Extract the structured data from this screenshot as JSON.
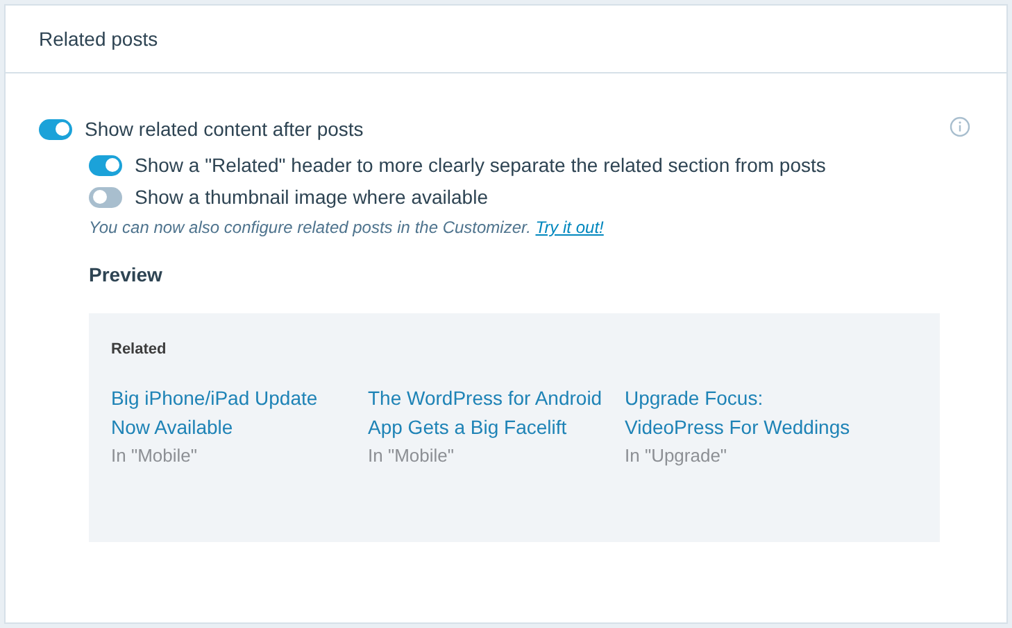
{
  "card": {
    "title": "Related posts"
  },
  "toggles": [
    {
      "label": "Show related content after posts",
      "on": true,
      "kind": "main"
    },
    {
      "label": "Show a \"Related\" header to more clearly separate the related section from posts",
      "on": true,
      "kind": "sub"
    },
    {
      "label": "Show a thumbnail image where available",
      "on": false,
      "kind": "sub"
    }
  ],
  "note": {
    "text": "You can now also configure related posts in the Customizer.",
    "link": "Try it out!"
  },
  "preview": {
    "title": "Preview",
    "heading": "Related",
    "posts": [
      {
        "title": "Big iPhone/iPad Update Now Available",
        "category": "In \"Mobile\""
      },
      {
        "title": "The WordPress for Android App Gets a Big Facelift",
        "category": "In \"Mobile\""
      },
      {
        "title": "Upgrade Focus: VideoPress For Weddings",
        "category": "In \"Upgrade\""
      }
    ]
  }
}
